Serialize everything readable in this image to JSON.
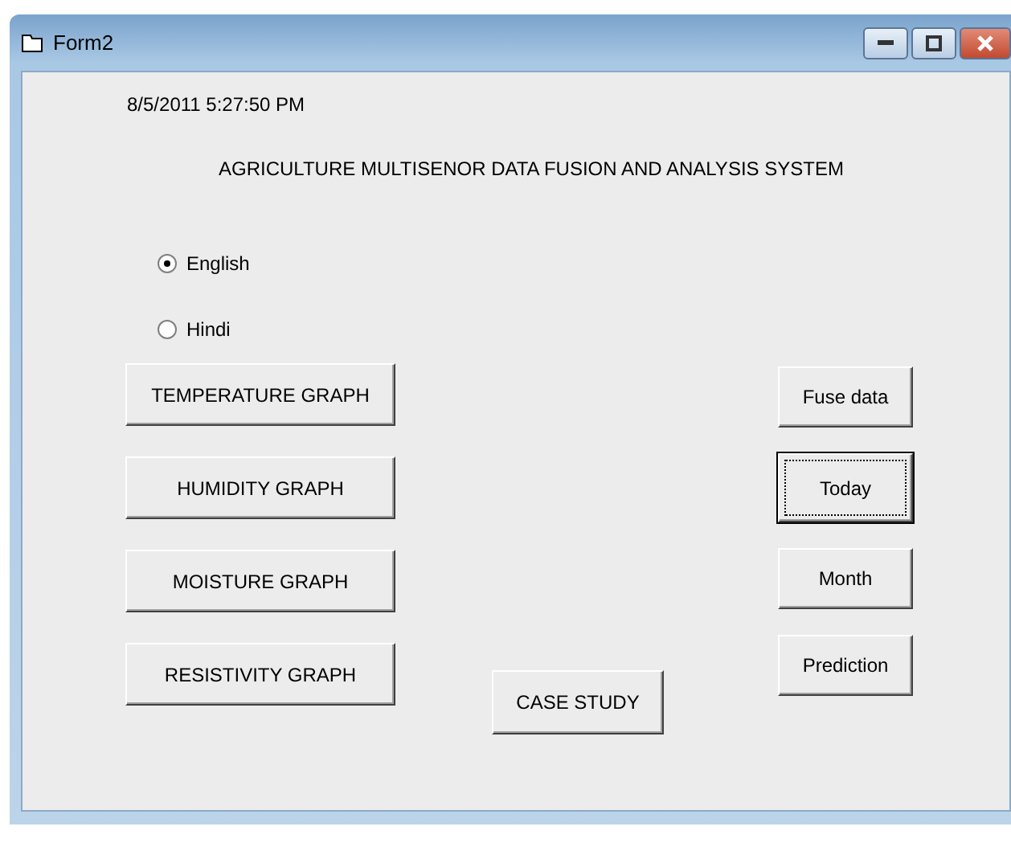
{
  "window": {
    "title": "Form2"
  },
  "datetime": "8/5/2011 5:27:50 PM",
  "heading": "AGRICULTURE MULTISENOR DATA FUSION AND ANALYSIS SYSTEM",
  "languages": [
    {
      "label": "English",
      "selected": true
    },
    {
      "label": "Hindi",
      "selected": false
    }
  ],
  "graph_buttons": [
    {
      "label": "TEMPERATURE GRAPH",
      "focused": false
    },
    {
      "label": "HUMIDITY GRAPH",
      "focused": false
    },
    {
      "label": "MOISTURE GRAPH",
      "focused": false
    },
    {
      "label": "RESISTIVITY GRAPH",
      "focused": false
    }
  ],
  "case_study_button": {
    "label": "CASE STUDY",
    "focused": false
  },
  "action_buttons": [
    {
      "label": "Fuse data",
      "focused": false
    },
    {
      "label": "Today",
      "focused": true
    },
    {
      "label": "Month",
      "focused": false
    },
    {
      "label": "Prediction",
      "focused": false
    }
  ]
}
